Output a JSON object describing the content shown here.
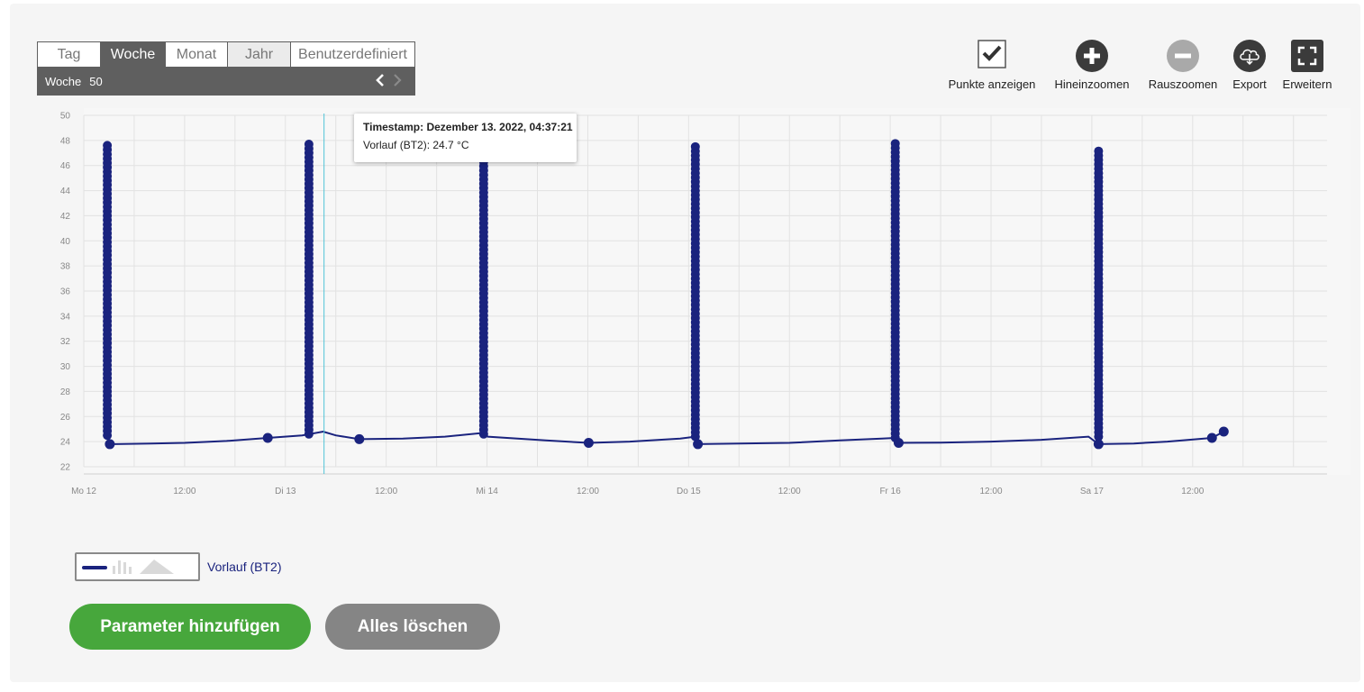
{
  "period": {
    "tabs": [
      {
        "label": "Tag",
        "active": false
      },
      {
        "label": "Woche",
        "active": true
      },
      {
        "label": "Monat",
        "active": false
      },
      {
        "label": "Jahr",
        "active": false
      },
      {
        "label": "Benutzerdefiniert",
        "active": false
      }
    ],
    "week_label": "Woche",
    "week_number": "50",
    "prev_icon": "chevron-left-icon",
    "next_icon": "chevron-right-icon"
  },
  "toolbar": {
    "show_points": "Punkte anzeigen",
    "zoom_in": "Hineinzoomen",
    "zoom_out": "Rauszoomen",
    "export": "Export",
    "expand": "Erweitern"
  },
  "tooltip": {
    "title": "Timestamp: Dezember 13. 2022, 04:37:21",
    "value": "Vorlauf (BT2): 24.7 °C"
  },
  "legend": {
    "label": "Vorlauf (BT2)",
    "color": "#1a237e"
  },
  "buttons": {
    "add": "Parameter hinzufügen",
    "clear": "Alles löschen"
  },
  "colors": {
    "series": "#1a237e",
    "add_button": "#47a73c",
    "clear_button": "#858585",
    "dark": "#3b3b3b",
    "cursor_line": "#4fc3d6"
  },
  "chart_data": {
    "type": "line",
    "x_unit": "hours from Mo 12 00:00",
    "xlim": [
      0,
      148
    ],
    "ylim": [
      22,
      50
    ],
    "yticks": [
      22,
      24,
      26,
      28,
      30,
      32,
      34,
      36,
      38,
      40,
      42,
      44,
      46,
      48,
      50
    ],
    "xticks": [
      {
        "x": 0,
        "label": "Mo 12"
      },
      {
        "x": 12,
        "label": "12:00"
      },
      {
        "x": 24,
        "label": "Di 13"
      },
      {
        "x": 36,
        "label": "12:00"
      },
      {
        "x": 48,
        "label": "Mi 14"
      },
      {
        "x": 60,
        "label": "12:00"
      },
      {
        "x": 72,
        "label": "Do 15"
      },
      {
        "x": 84,
        "label": "12:00"
      },
      {
        "x": 96,
        "label": "Fr 16"
      },
      {
        "x": 108,
        "label": "12:00"
      },
      {
        "x": 120,
        "label": "Sa 17"
      },
      {
        "x": 132,
        "label": "12:00"
      }
    ],
    "grid": true,
    "cursor_x": 28.6,
    "series": [
      {
        "name": "Vorlauf (BT2)",
        "line": [
          [
            2.8,
            24.8
          ],
          [
            3.1,
            23.8
          ],
          [
            8,
            23.85
          ],
          [
            12,
            23.9
          ],
          [
            17,
            24.05
          ],
          [
            21.9,
            24.3
          ],
          [
            26,
            24.5
          ],
          [
            28.5,
            24.8
          ],
          [
            30,
            24.5
          ],
          [
            32.8,
            24.2
          ],
          [
            38,
            24.25
          ],
          [
            43,
            24.4
          ],
          [
            47.6,
            24.7
          ],
          [
            48.1,
            24.4
          ],
          [
            55,
            24.1
          ],
          [
            60.1,
            23.9
          ],
          [
            65,
            24.0
          ],
          [
            71,
            24.25
          ],
          [
            72.8,
            24.4
          ],
          [
            73.1,
            23.8
          ],
          [
            78,
            23.85
          ],
          [
            84,
            23.9
          ],
          [
            90,
            24.1
          ],
          [
            95,
            24.25
          ],
          [
            96.6,
            24.3
          ],
          [
            97,
            23.9
          ],
          [
            102,
            23.92
          ],
          [
            108,
            24.0
          ],
          [
            114,
            24.15
          ],
          [
            119.6,
            24.4
          ],
          [
            120.8,
            23.8
          ],
          [
            125,
            23.85
          ],
          [
            129,
            24.0
          ],
          [
            134.3,
            24.3
          ],
          [
            135.7,
            24.8
          ]
        ],
        "spikes": [
          {
            "x": 2.8,
            "from": 24.5,
            "to": 47.7
          },
          {
            "x": 26.8,
            "from": 24.6,
            "to": 47.7
          },
          {
            "x": 47.6,
            "from": 24.6,
            "to": 47.7
          },
          {
            "x": 72.8,
            "from": 24.4,
            "to": 47.7
          },
          {
            "x": 96.6,
            "from": 24.3,
            "to": 47.8
          },
          {
            "x": 120.8,
            "from": 24.4,
            "to": 47.3
          }
        ],
        "points": [
          [
            3.1,
            23.8
          ],
          [
            21.9,
            24.3
          ],
          [
            32.8,
            24.2
          ],
          [
            60.1,
            23.9
          ],
          [
            73.1,
            23.8
          ],
          [
            97,
            23.9
          ],
          [
            120.8,
            23.8
          ],
          [
            134.3,
            24.3
          ],
          [
            135.7,
            24.8
          ]
        ]
      }
    ]
  }
}
